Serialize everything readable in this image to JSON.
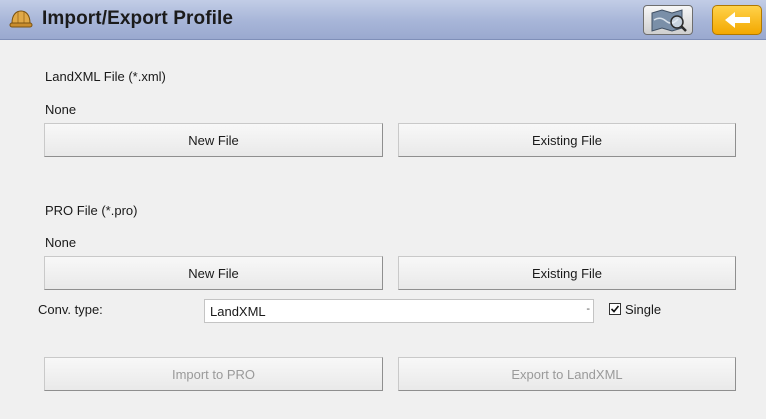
{
  "window": {
    "title": "Import/Export Profile",
    "icons": {
      "app": "hard-hat-icon",
      "map": "map-view-icon",
      "back": "back-arrow-icon"
    }
  },
  "landxml": {
    "label": "LandXML File (*.xml)",
    "value": "None",
    "new_file_label": "New File",
    "existing_file_label": "Existing File"
  },
  "pro": {
    "label": "PRO File (*.pro)",
    "value": "None",
    "new_file_label": "New File",
    "existing_file_label": "Existing File"
  },
  "conversion": {
    "label": "Conv. type:",
    "selected": "LandXML",
    "single_label": "Single",
    "single_checked": true
  },
  "actions": {
    "import_label": "Import to PRO",
    "export_label": "Export to LandXML"
  },
  "colors": {
    "accent_back": "#f3a800",
    "titlebar": "#a7b5d8"
  }
}
